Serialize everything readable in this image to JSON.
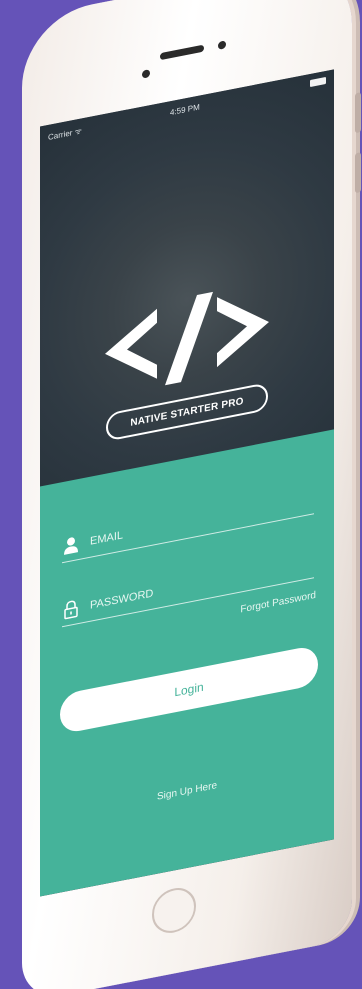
{
  "status_bar": {
    "carrier": "Carrier ᯤ",
    "time": "4:59 PM"
  },
  "app": {
    "logo_icon": "code-brackets-icon",
    "brand": "NATIVE STARTER PRO"
  },
  "login_form": {
    "email_placeholder": "EMAIL",
    "email_icon": "user-icon",
    "password_placeholder": "PASSWORD",
    "password_icon": "lock-icon",
    "forgot_password": "Forgot Password",
    "login_label": "Login",
    "signup_label": "Sign Up Here"
  },
  "colors": {
    "background": "#6553b8",
    "header": "#2e3942",
    "form_accent": "#45b39a",
    "button": "#ffffff"
  }
}
